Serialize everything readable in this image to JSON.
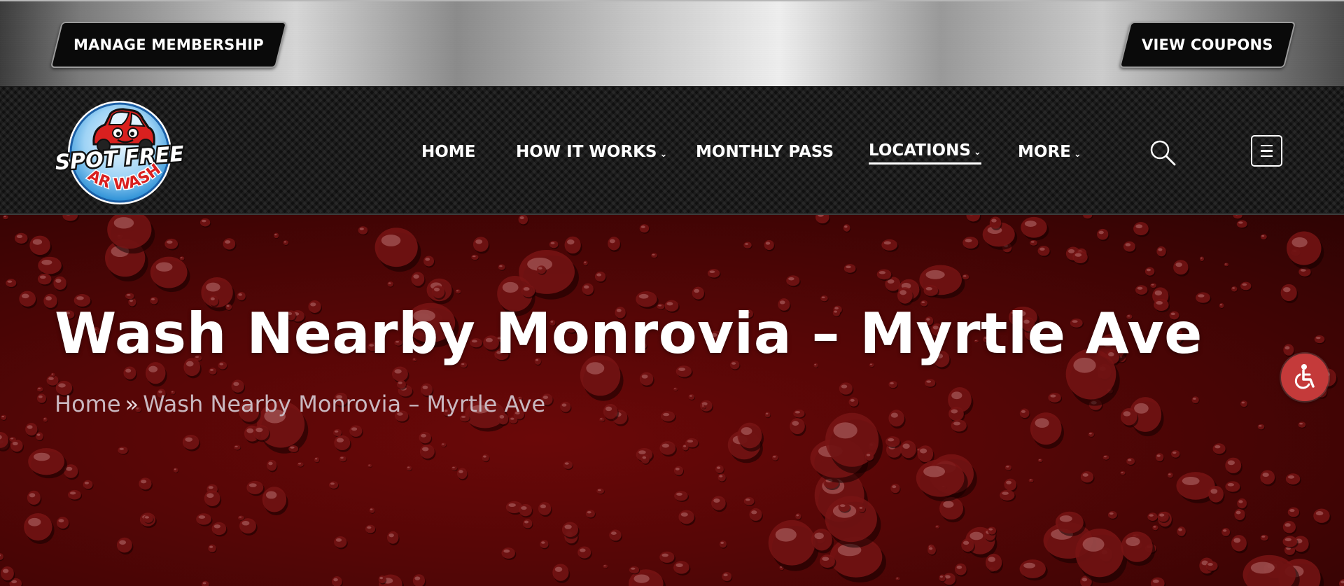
{
  "topbar": {
    "manage_label": "MANAGE MEMBERSHIP",
    "coupons_label": "VIEW COUPONS"
  },
  "logo": {
    "line1": "SPOT FREE",
    "line2": "CAR WASH"
  },
  "nav": {
    "items": [
      {
        "label": "HOME",
        "dropdown": false
      },
      {
        "label": "HOW IT WORKS",
        "dropdown": true
      },
      {
        "label": "MONTHLY PASS",
        "dropdown": false
      },
      {
        "label": "LOCATIONS",
        "dropdown": true,
        "active": true
      },
      {
        "label": "MORE",
        "dropdown": true
      }
    ],
    "caret": "⌄"
  },
  "hero": {
    "title": "Wash Nearby Monrovia – Myrtle Ave",
    "breadcrumb": {
      "home": "Home",
      "separator": "»",
      "current": "Wash Nearby Monrovia – Myrtle Ave"
    }
  },
  "icons": {
    "search": "search-icon",
    "menu": "menu-icon",
    "accessibility": "accessibility-icon"
  },
  "colors": {
    "hero_red": "#550606",
    "accessibility_button": "#c43a3a",
    "logo_red": "#d9201f",
    "logo_blue": "#2a8fd6"
  }
}
